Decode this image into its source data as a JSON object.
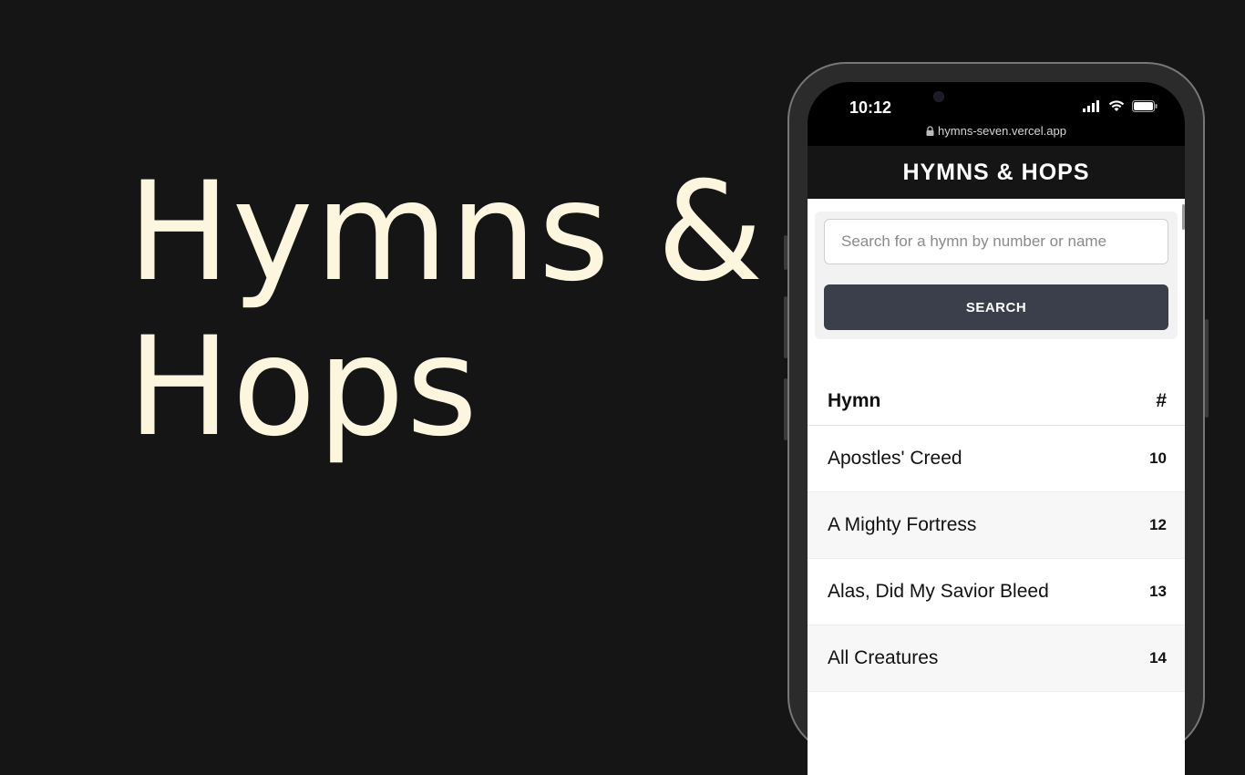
{
  "hero": {
    "line1": "Hymns &",
    "line2": "Hops"
  },
  "phone": {
    "status": {
      "time": "10:12",
      "icons": [
        "cellular-signal-icon",
        "wifi-icon",
        "battery-icon"
      ]
    },
    "url": "hymns-seven.vercel.app",
    "app_title": "HYMNS & HOPS",
    "search": {
      "placeholder": "Search for a hymn by number or name",
      "value": "",
      "button_label": "SEARCH"
    },
    "table": {
      "headers": {
        "name": "Hymn",
        "number": "#"
      },
      "rows": [
        {
          "name": "Apostles' Creed",
          "number": "10"
        },
        {
          "name": "A Mighty Fortress",
          "number": "12"
        },
        {
          "name": "Alas, Did My Savior Bleed",
          "number": "13"
        },
        {
          "name": "All Creatures",
          "number": "14"
        }
      ]
    }
  },
  "colors": {
    "background": "#151515",
    "hero_text": "#fbf6dd",
    "button": "#3a3f4b"
  }
}
